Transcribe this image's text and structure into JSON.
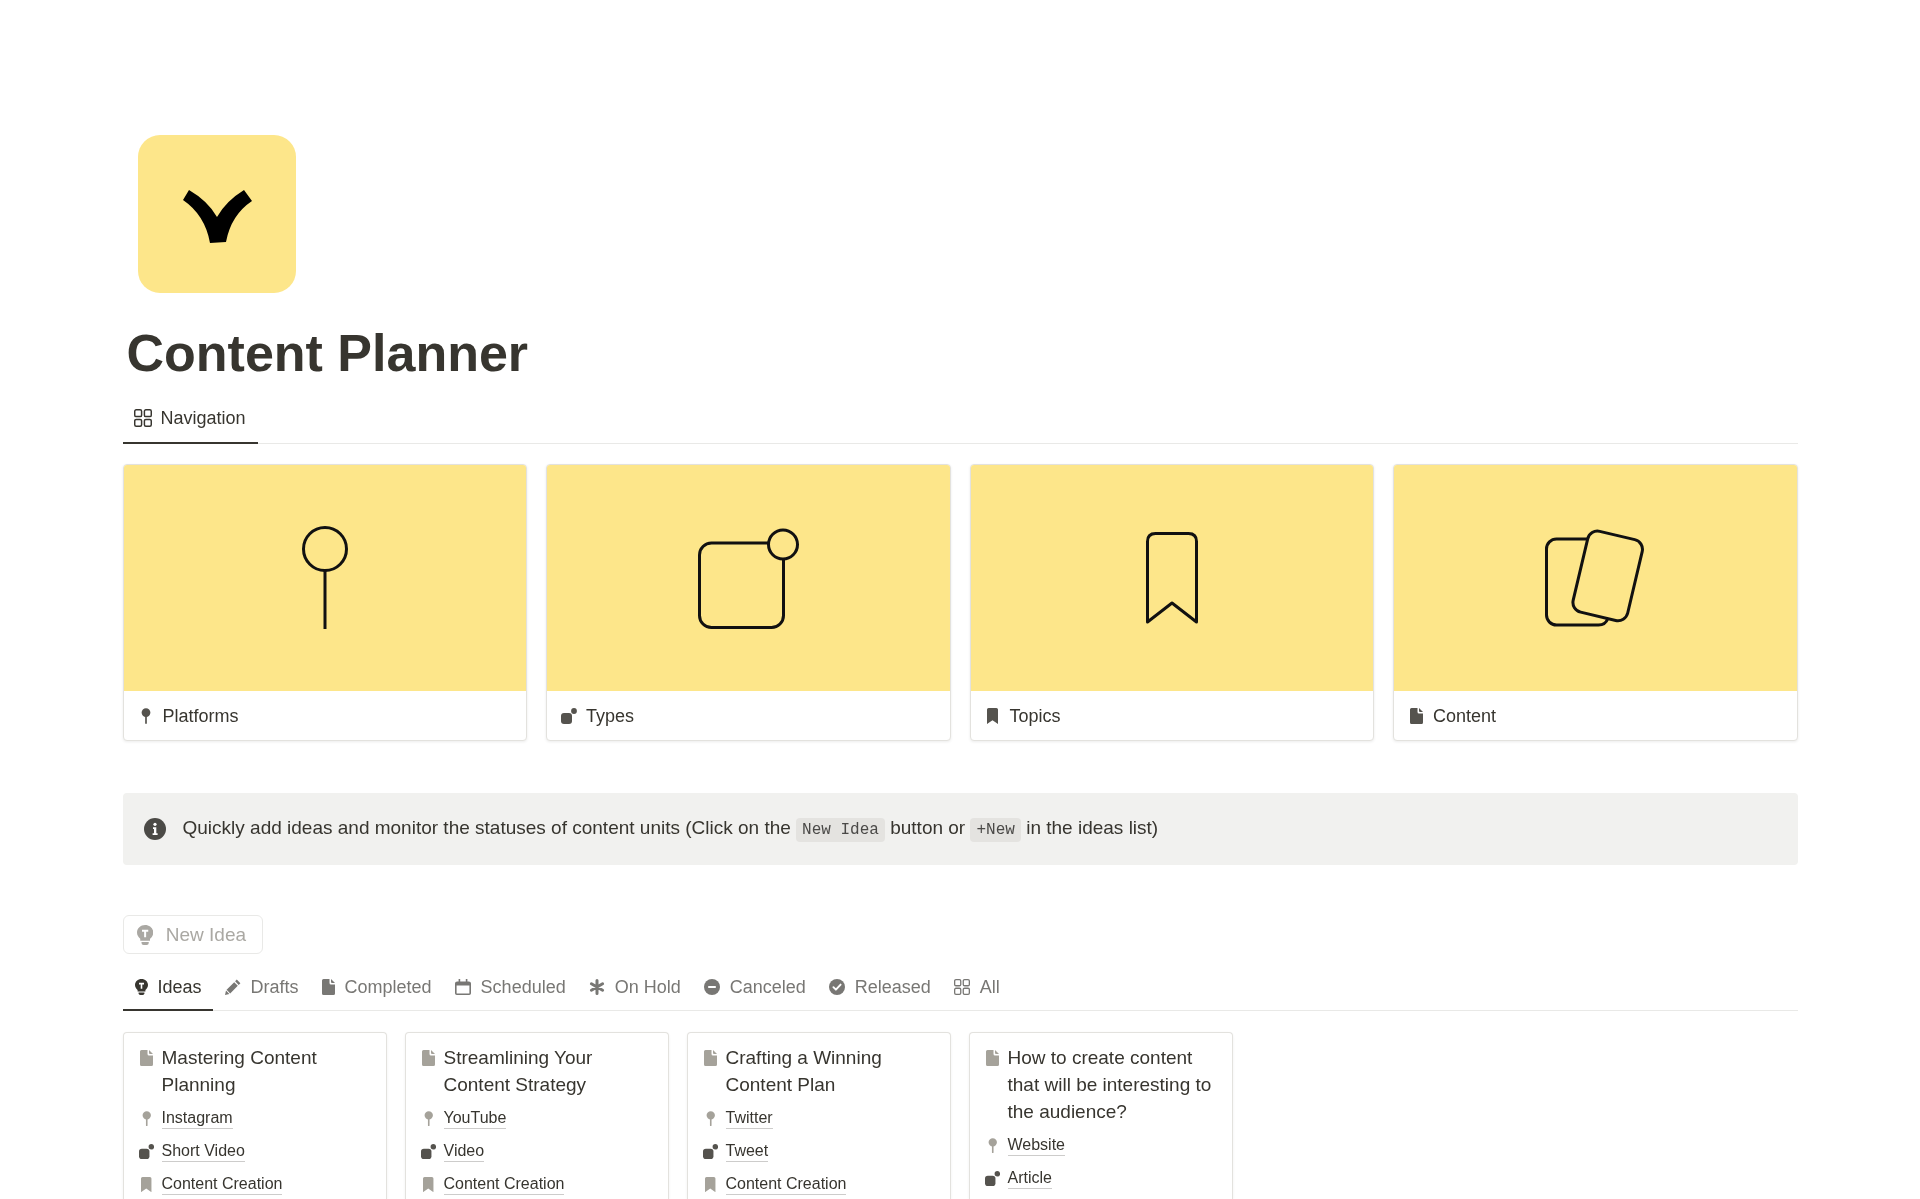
{
  "page": {
    "title": "Content Planner"
  },
  "view_tabs": [
    {
      "label": "Navigation",
      "selected": true
    }
  ],
  "navigation_cards": [
    {
      "label": "Platforms",
      "kind": "pin"
    },
    {
      "label": "Types",
      "kind": "shapes"
    },
    {
      "label": "Topics",
      "kind": "bookmark"
    },
    {
      "label": "Content",
      "kind": "pages"
    }
  ],
  "callout": {
    "segments": [
      {
        "kind": "text",
        "text": "Quickly add ideas and monitor the statuses of content units (Click on the "
      },
      {
        "kind": "code",
        "text": "New Idea"
      },
      {
        "kind": "text",
        "text": " button or "
      },
      {
        "kind": "code",
        "text": "+New"
      },
      {
        "kind": "text",
        "text": " in the ideas list)"
      }
    ]
  },
  "new_idea_button": {
    "label": "New Idea"
  },
  "status_tabs": [
    {
      "label": "Ideas",
      "kind": "bulb",
      "selected": true
    },
    {
      "label": "Drafts",
      "kind": "pencil",
      "selected": false
    },
    {
      "label": "Completed",
      "kind": "document",
      "selected": false
    },
    {
      "label": "Scheduled",
      "kind": "calendar",
      "selected": false
    },
    {
      "label": "On Hold",
      "kind": "asterisk",
      "selected": false
    },
    {
      "label": "Canceled",
      "kind": "minus",
      "selected": false
    },
    {
      "label": "Released",
      "kind": "check",
      "selected": false
    },
    {
      "label": "All",
      "kind": "grid",
      "selected": false
    }
  ],
  "idea_cards": [
    {
      "title": "Mastering Content Planning",
      "properties": [
        {
          "kind": "platform",
          "value": "Instagram"
        },
        {
          "kind": "type",
          "value": "Short Video"
        },
        {
          "kind": "topic",
          "value": "Content Creation"
        }
      ]
    },
    {
      "title": "Streamlining Your Content Strategy",
      "properties": [
        {
          "kind": "platform",
          "value": "YouTube"
        },
        {
          "kind": "type",
          "value": "Video"
        },
        {
          "kind": "topic",
          "value": "Content Creation"
        }
      ]
    },
    {
      "title": "Crafting a Winning Content Plan",
      "properties": [
        {
          "kind": "platform",
          "value": "Twitter"
        },
        {
          "kind": "type",
          "value": "Tweet"
        },
        {
          "kind": "topic",
          "value": "Content Creation"
        }
      ]
    },
    {
      "title": "How to create content that will be interesting to the audience?",
      "properties": [
        {
          "kind": "platform",
          "value": "Website"
        },
        {
          "kind": "type",
          "value": "Article"
        }
      ]
    }
  ]
}
